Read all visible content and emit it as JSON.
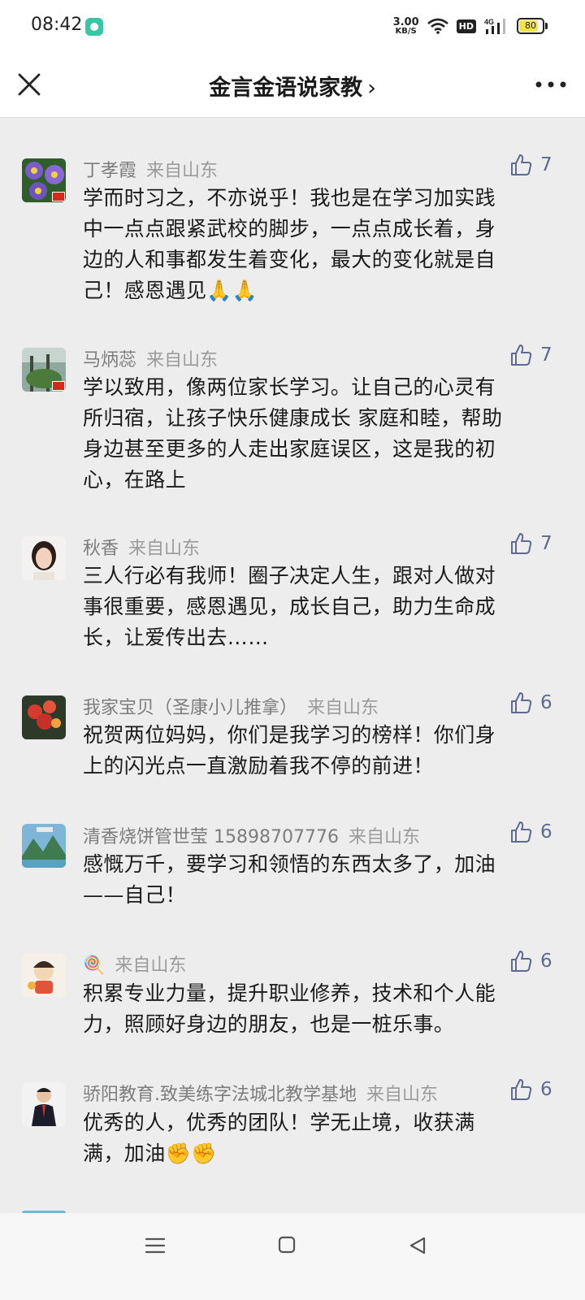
{
  "status_bar": {
    "time": "08:42",
    "net_speed_value": "3.00",
    "net_speed_unit": "KB/S",
    "hd": "HD",
    "network": "4G",
    "battery": "80"
  },
  "nav": {
    "title": "金言金语说家教",
    "chevron": "›"
  },
  "comments": [
    {
      "name": "丁孝霞",
      "location": "来自山东",
      "likes": "7",
      "lines": [
        "学而时习之，不亦说乎！我也是在学习加实践",
        "中一点点跟紧武校的脚步，一点点成长着，身",
        "边的人和事都发生着变化，最大的变化就是自",
        "己！感恩遇见🙏🙏"
      ]
    },
    {
      "name": "马炳蕊",
      "location": "来自山东",
      "likes": "7",
      "lines": [
        "学以致用，像两位家长学习。让自己的心灵有",
        "所归宿，让孩子快乐健康成长 家庭和睦，帮助",
        "身边甚至更多的人走出家庭误区，这是我的初",
        "心，在路上"
      ]
    },
    {
      "name": "秋香",
      "location": "来自山东",
      "likes": "7",
      "lines": [
        "三人行必有我师！圈子决定人生，跟对人做对",
        "事很重要，感恩遇见，成长自己，助力生命成",
        "长，让爱传出去……"
      ]
    },
    {
      "name": "我家宝贝（圣康小儿推拿）",
      "location": "来自山东",
      "likes": "6",
      "lines": [
        "祝贺两位妈妈，你们是我学习的榜样！你们身",
        "上的闪光点一直激励着我不停的前进！"
      ]
    },
    {
      "name": "清香烧饼管世莹 15898707776",
      "location": "来自山东",
      "likes": "6",
      "lines": [
        "感慨万千，要学习和领悟的东西太多了，加油",
        "——自己！"
      ]
    },
    {
      "name": "🍭",
      "location": "来自山东",
      "likes": "6",
      "lines": [
        "积累专业力量，提升职业修养，技术和个人能",
        "力，照顾好身边的朋友，也是一桩乐事。"
      ]
    },
    {
      "name": "骄阳教育.致美练字法城北教学基地",
      "location": "来自山东",
      "likes": "6",
      "lines": [
        "优秀的人，优秀的团队！学无止境，收获满",
        "满，加油✊✊"
      ]
    }
  ],
  "icons": {
    "close": "close-icon",
    "more": "more-icon",
    "like": "thumbs-up-icon",
    "nav_menu": "menu-icon",
    "nav_home": "square-home-icon",
    "nav_back": "triangle-back-icon"
  },
  "colors": {
    "like_accent": "#5c6a94",
    "background": "#ededed"
  }
}
